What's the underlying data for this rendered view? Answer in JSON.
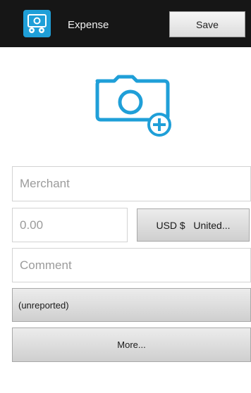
{
  "header": {
    "app_icon": "expense-app-icon",
    "title": "Expense",
    "save_label": "Save"
  },
  "camera": {
    "icon": "add-photo-camera-icon",
    "color": "#1f9fd8"
  },
  "form": {
    "merchant_placeholder": "Merchant",
    "amount_placeholder": "0.00",
    "currency_label": "USD $",
    "currency_country": "United...",
    "comment_placeholder": "Comment",
    "report_label": "(unreported)",
    "more_label": "More..."
  },
  "colors": {
    "topbar": "#161616",
    "accent": "#1f9fd8"
  }
}
